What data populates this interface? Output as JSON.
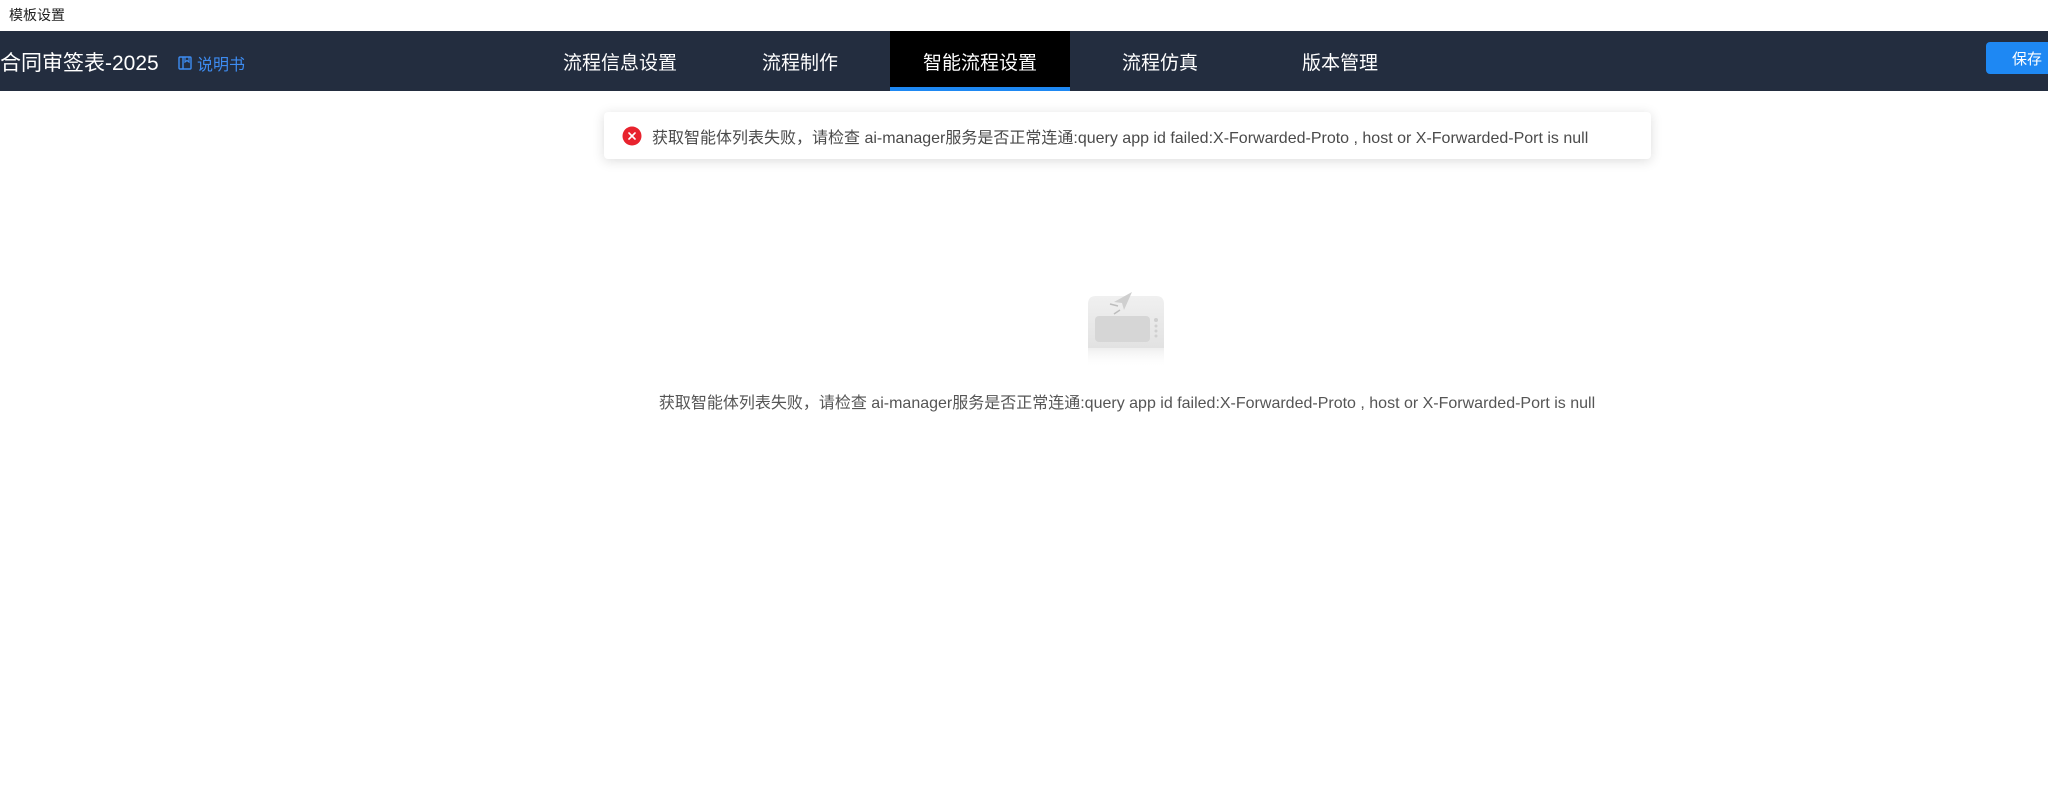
{
  "window": {
    "title": "模板设置"
  },
  "header": {
    "doc_title": "合同审签表-2025",
    "manual_label": "说明书",
    "tabs": [
      {
        "label": "流程信息设置",
        "active": false
      },
      {
        "label": "流程制作",
        "active": false
      },
      {
        "label": "智能流程设置",
        "active": true
      },
      {
        "label": "流程仿真",
        "active": false
      },
      {
        "label": "版本管理",
        "active": false
      }
    ],
    "save_label": "保存"
  },
  "toast": {
    "type": "error",
    "message": "获取智能体列表失败，请检查 ai-manager服务是否正常连通:query app id failed:X-Forwarded-Proto , host or X-Forwarded-Port is null"
  },
  "empty_state": {
    "message": "获取智能体列表失败，请检查 ai-manager服务是否正常连通:query app id failed:X-Forwarded-Proto , host or X-Forwarded-Port is null"
  },
  "colors": {
    "topbar_bg": "#232d3f",
    "active_tab_bg": "#000000",
    "accent": "#1e88f3",
    "link": "#3d8cf2",
    "error": "#e8232e"
  }
}
